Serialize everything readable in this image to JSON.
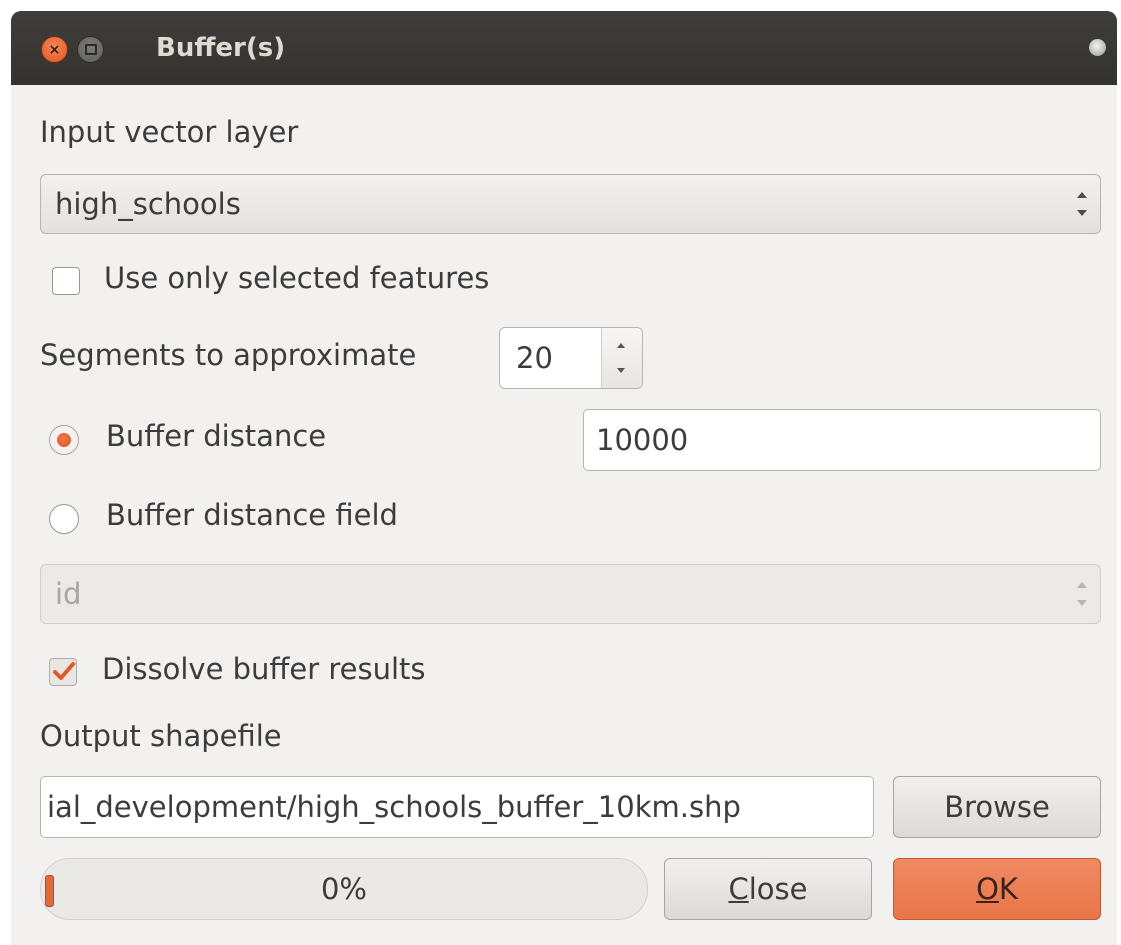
{
  "window": {
    "title": "Buffer(s)"
  },
  "input_layer": {
    "label": "Input vector layer",
    "selected": "high_schools"
  },
  "use_selected": {
    "label": "Use only selected features",
    "checked": false
  },
  "segments": {
    "label": "Segments to approximate",
    "value": "20"
  },
  "buffer_distance": {
    "label": "Buffer distance",
    "value": "10000",
    "selected": true
  },
  "buffer_distance_field": {
    "label": "Buffer distance field",
    "selected": false,
    "field_value": "id"
  },
  "dissolve": {
    "label": "Dissolve buffer results",
    "checked": true
  },
  "output": {
    "label": "Output shapefile",
    "value": "ial_development/high_schools_buffer_10km.shp",
    "browse_label": "Browse"
  },
  "progress": {
    "value": 0,
    "text": "0%"
  },
  "buttons": {
    "close_prefix": "C",
    "close_rest": "lose",
    "ok_prefix": "O",
    "ok_rest": "K"
  },
  "colors": {
    "accent": "#e87548",
    "titlebar": "#3a3936",
    "background": "#f2f1f0"
  }
}
